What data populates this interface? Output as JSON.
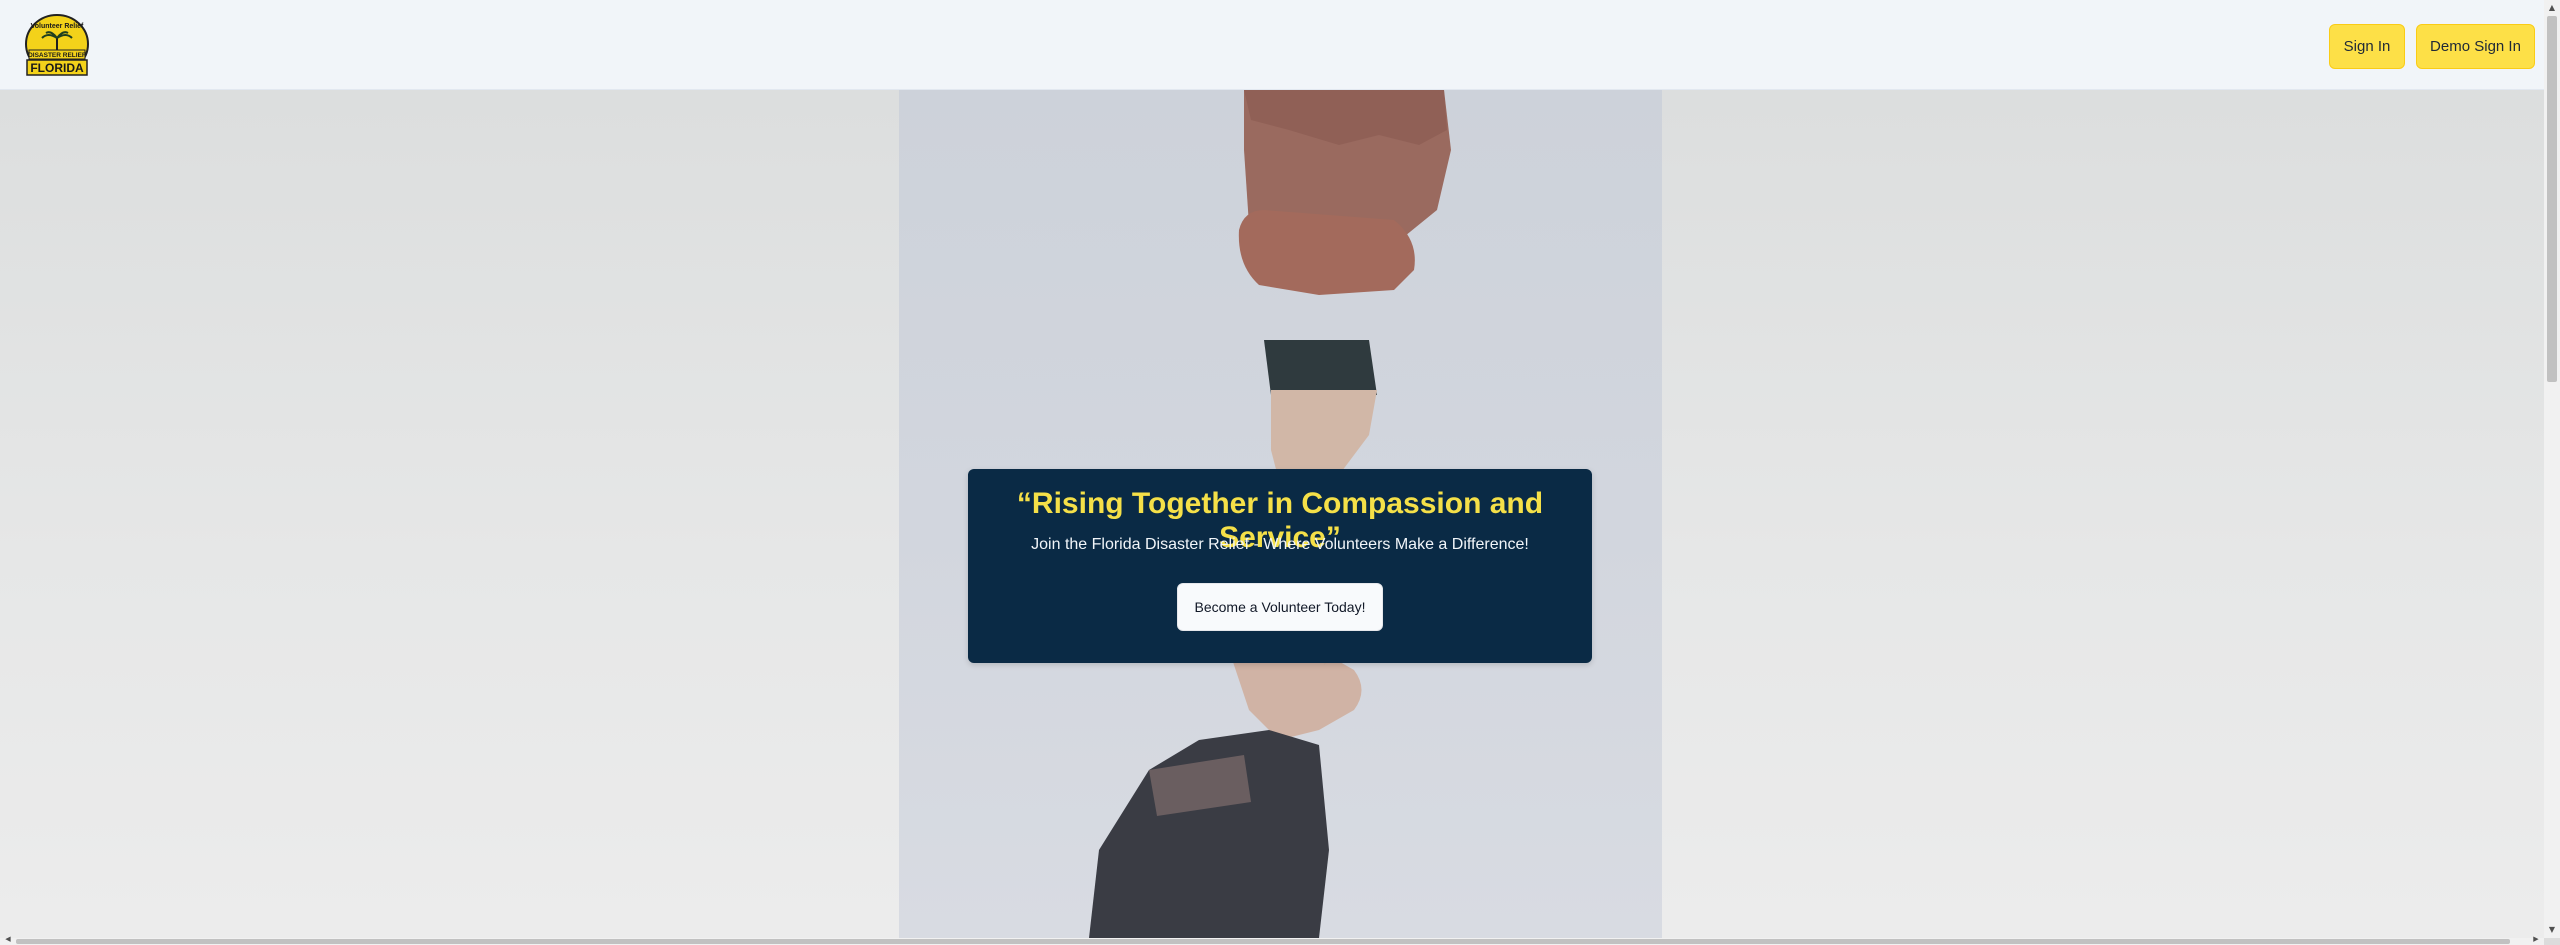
{
  "header": {
    "logo_text": {
      "top": "Volunteer Relief",
      "middle": "DISASTER RELIEF",
      "bottom": "FLORIDA"
    },
    "sign_in_label": "Sign In",
    "demo_sign_in_label": "Demo Sign In"
  },
  "hero": {
    "headline": "“Rising Together in Compassion and Service”",
    "subheadline": "Join the Florida Disaster Relief - Where Volunteers Make a Difference!",
    "cta_label": "Become a Volunteer Today!"
  },
  "colors": {
    "accent_yellow": "#fde047",
    "headline_yellow": "#f5e048",
    "banner_navy": "#0a2a45",
    "header_bg": "#f1f5f9"
  },
  "icons": {
    "logo": "palm-tree-sun-logo",
    "scroll_up": "scroll-up-arrow",
    "scroll_down": "scroll-down-arrow",
    "scroll_left": "scroll-left-arrow",
    "scroll_right": "scroll-right-arrow"
  }
}
